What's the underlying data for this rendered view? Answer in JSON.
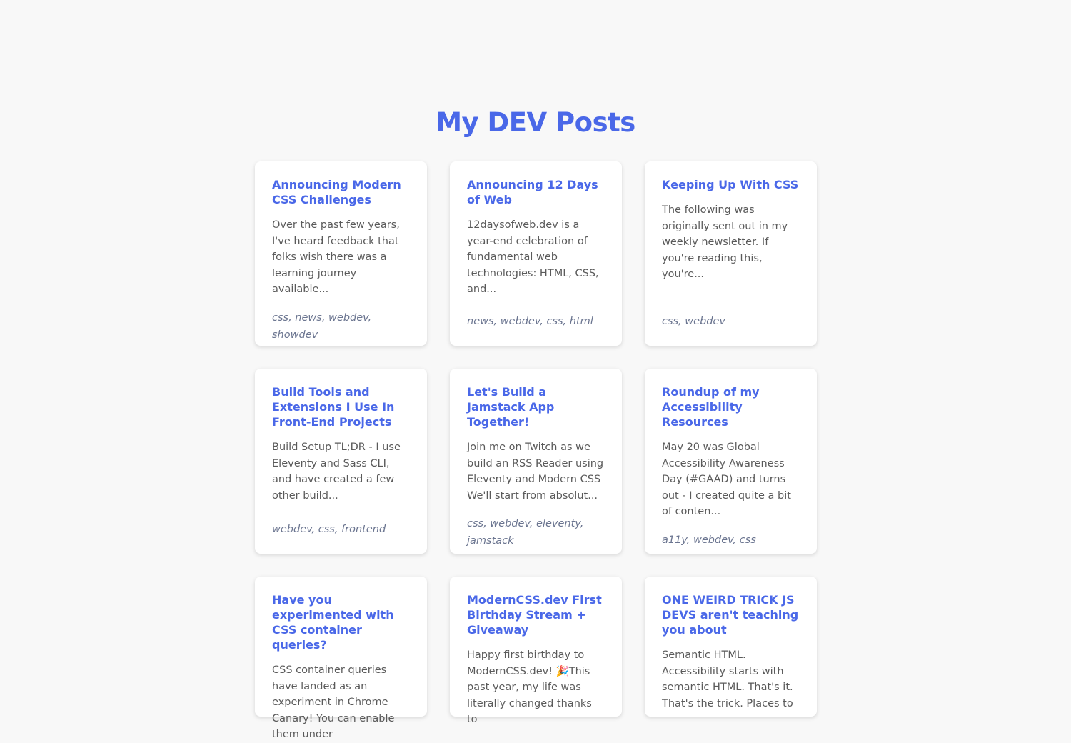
{
  "page": {
    "title": "My DEV Posts"
  },
  "posts": [
    {
      "title": "Announcing Modern CSS Challenges",
      "excerpt": "Over the past few years, I've heard feedback that folks wish there was a learning journey available...",
      "tags": "css, news, webdev, showdev"
    },
    {
      "title": "Announcing 12 Days of Web",
      "excerpt": "12daysofweb.dev is a year-end celebration of fundamental web technologies: HTML, CSS, and...",
      "tags": "news, webdev, css, html"
    },
    {
      "title": "Keeping Up With CSS",
      "excerpt": "The following was originally sent out in my weekly newsletter. If you're reading this, you're...",
      "tags": "css, webdev"
    },
    {
      "title": "Build Tools and Extensions I Use In Front-End Projects",
      "excerpt": "Build Setup TL;DR - I use Eleventy and Sass CLI, and have created a few other build...",
      "tags": "webdev, css, frontend"
    },
    {
      "title": "Let's Build a Jamstack App Together!",
      "excerpt": "Join me on Twitch as we build an RSS Reader using Eleventy and Modern CSS We'll start from absolut...",
      "tags": "css, webdev, eleventy, jamstack"
    },
    {
      "title": "Roundup of my Accessibility Resources",
      "excerpt": "May 20 was Global Accessibility Awareness Day (#GAAD) and turns out - I created quite a bit of conten...",
      "tags": "a11y, webdev, css"
    },
    {
      "title": "Have you experimented with CSS container queries?",
      "excerpt": "CSS container queries have landed as an experiment in Chrome Canary! You can enable them under",
      "tags": ""
    },
    {
      "title": "ModernCSS.dev First Birthday Stream + Giveaway",
      "excerpt": "Happy first birthday to ModernCSS.dev! 🎉This past year, my life was literally changed thanks to",
      "tags": ""
    },
    {
      "title": "ONE WEIRD TRICK JS DEVS aren't teaching you about",
      "excerpt": "Semantic HTML. Accessibility starts with semantic HTML. That's it. That's the trick. Places to",
      "tags": ""
    }
  ]
}
